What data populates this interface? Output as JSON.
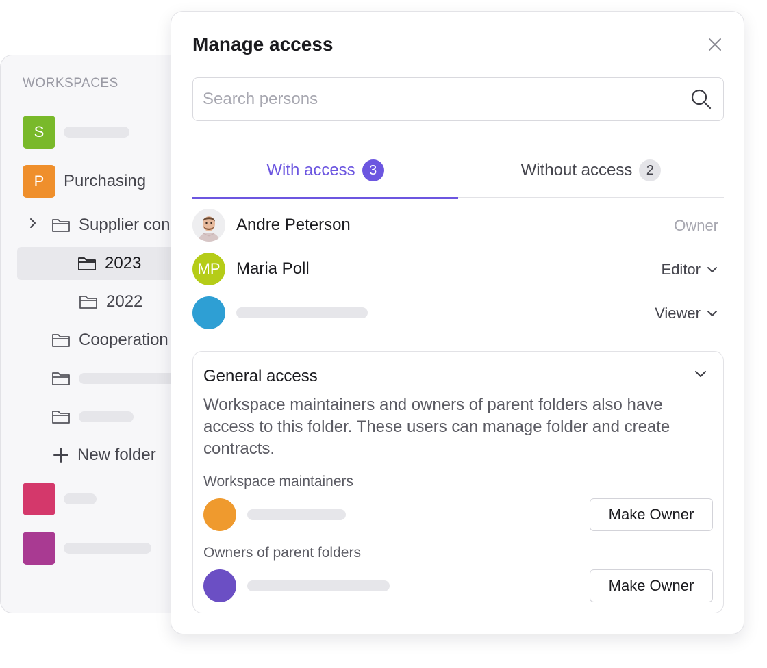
{
  "sidebar": {
    "heading": "WORKSPACES",
    "workspaces": [
      {
        "initial": "S",
        "label": "",
        "color": "#79b92a"
      },
      {
        "initial": "P",
        "label": "Purchasing",
        "color": "#ef8f2c"
      },
      {
        "initial": "",
        "label": "",
        "color": "#d4386b"
      },
      {
        "initial": "",
        "label": "",
        "color": "#a93a92"
      }
    ],
    "folders": [
      {
        "label": "Supplier con"
      },
      {
        "label": "2023",
        "selected": true
      },
      {
        "label": "2022"
      },
      {
        "label": "Cooperation"
      }
    ],
    "new_folder_label": "New folder"
  },
  "modal": {
    "title": "Manage access",
    "search": {
      "placeholder": "Search persons",
      "value": ""
    },
    "tabs": [
      {
        "label": "With access",
        "count": "3",
        "active": true
      },
      {
        "label": "Without access",
        "count": "2",
        "active": false
      }
    ],
    "people": [
      {
        "name": "Andre Peterson",
        "role": "Owner",
        "editable": false,
        "avatar": "photo"
      },
      {
        "name": "Maria Poll",
        "initials": "MP",
        "role": "Editor",
        "editable": true,
        "color": "#b5cc18"
      },
      {
        "name": "",
        "role": "Viewer",
        "editable": true,
        "color": "#2e9fd4"
      }
    ],
    "general_access": {
      "title": "General access",
      "description": "Workspace maintainers and owners of parent folders also have access to this folder. These users can manage folder and create contracts.",
      "sections": [
        {
          "label": "Workspace maintainers",
          "button": "Make Owner",
          "color": "#ef9a2e"
        },
        {
          "label": "Owners of parent folders",
          "button": "Make Owner",
          "color": "#6b4fc4"
        }
      ]
    }
  },
  "colors": {
    "accent": "#6c56e0",
    "placeholder": "#e6e6ea"
  }
}
